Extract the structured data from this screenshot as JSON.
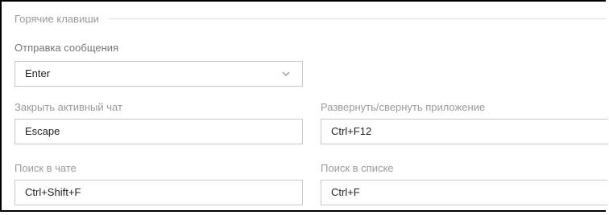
{
  "section": {
    "title": "Горячие клавиши"
  },
  "send_message": {
    "label": "Отправка сообщения",
    "value": "Enter",
    "icon": "chevron-down-icon"
  },
  "close_chat": {
    "label": "Закрыть активный чат",
    "value": "Escape"
  },
  "toggle_app": {
    "label": "Развернуть/свернуть приложение",
    "value": "Ctrl+F12"
  },
  "search_chat": {
    "label": "Поиск в чате",
    "value": "Ctrl+Shift+F"
  },
  "search_list": {
    "label": "Поиск в списке",
    "value": "Ctrl+F"
  }
}
